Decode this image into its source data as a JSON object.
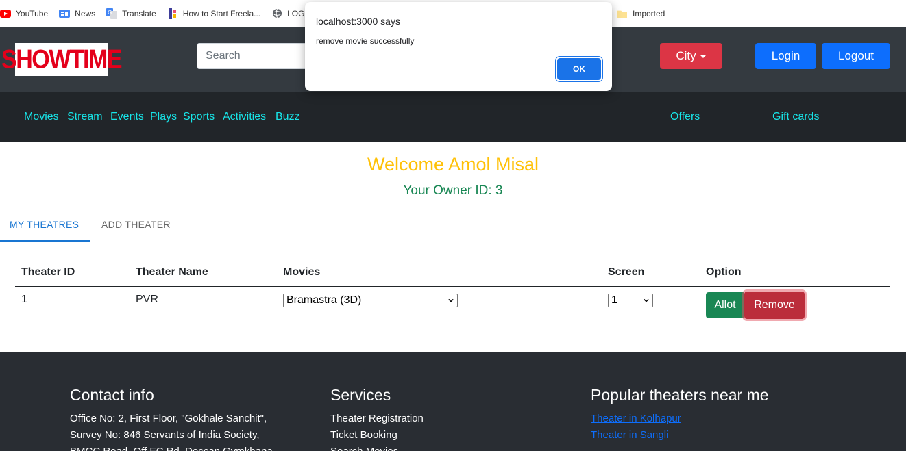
{
  "bookmarks": [
    {
      "label": "YouTube",
      "icon": "youtube-icon"
    },
    {
      "label": "News",
      "icon": "google-news-icon"
    },
    {
      "label": "Translate",
      "icon": "google-translate-icon"
    },
    {
      "label": "How to Start Freela...",
      "icon": "freelance-icon"
    },
    {
      "label": "LOGI",
      "icon": "globe-icon"
    },
    {
      "label": "Imported",
      "icon": "folder-icon"
    }
  ],
  "header": {
    "logo_text": "SHOWTIME",
    "search_placeholder": "Search",
    "city_label": "City",
    "login_label": "Login",
    "logout_label": "Logout"
  },
  "nav": {
    "items": [
      "Movies",
      "Stream",
      "Events",
      "Plays",
      "Sports",
      "Activities",
      "Buzz"
    ],
    "offers": "Offers",
    "gift_cards": "Gift cards"
  },
  "welcome": {
    "title": "Welcome Amol Misal",
    "owner_id": "Your Owner ID: 3"
  },
  "tabs": [
    "MY THEATRES",
    "ADD THEATER"
  ],
  "table": {
    "headers": [
      "Theater ID",
      "Theater Name",
      "Movies",
      "Screen",
      "Option"
    ],
    "rows": [
      {
        "id": "1",
        "name": "PVR",
        "movie": "Bramastra (3D)",
        "screen": "1"
      }
    ],
    "allot_label": "Allot",
    "remove_label": "Remove"
  },
  "footer": {
    "contact_title": "Contact info",
    "contact_lines": [
      "Office No: 2, First Floor, \"Gokhale Sanchit\",",
      "Survey No: 846 Servants of India Society,",
      "BMCC Road, Off FC Rd, Deccan Gymkhana"
    ],
    "services_title": "Services",
    "services": [
      "Theater Registration",
      "Ticket Booking",
      "Search Movies"
    ],
    "popular_title": "Popular theaters near me",
    "popular": [
      "Theater in Kolhapur",
      "Theater in Sangli"
    ]
  },
  "dialog": {
    "title": "localhost:3000 says",
    "message": "remove movie successfully",
    "ok_label": "OK"
  },
  "colors": {
    "header_bg": "#343a40",
    "nav_bg": "#212529",
    "nav_link": "#17e5e8",
    "welcome": "#ffc107",
    "owner_id": "#198754",
    "city_btn": "#dc3545",
    "login_btn": "#0d6efd",
    "footer_bg": "#292d33"
  }
}
